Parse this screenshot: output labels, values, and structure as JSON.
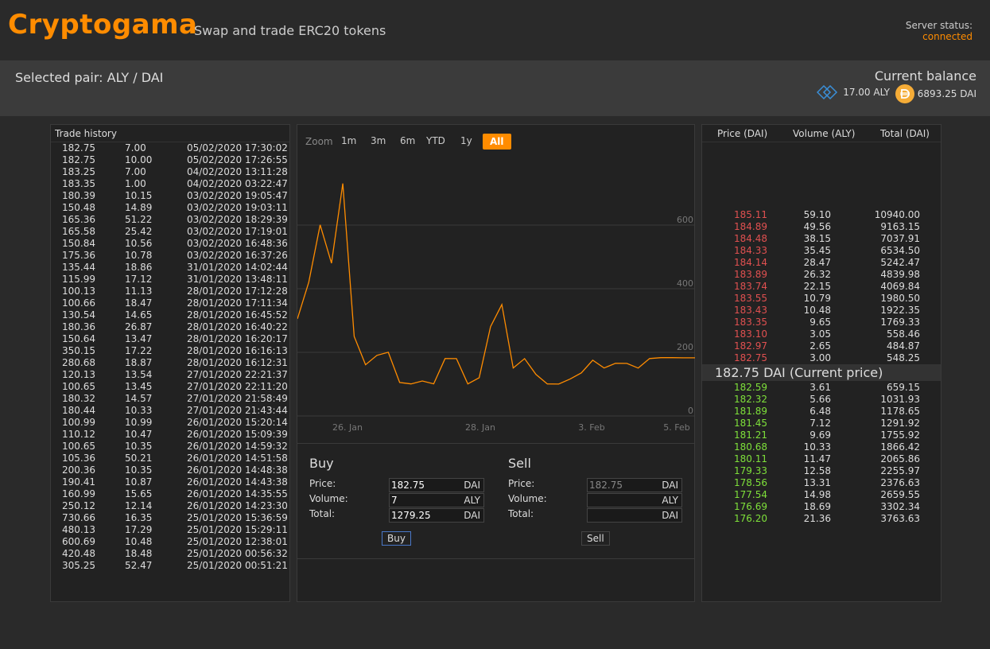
{
  "app": {
    "name": "Cryptogama",
    "tagline": "Swap and trade ERC20 tokens"
  },
  "server": {
    "label": "Server status:",
    "status": "connected"
  },
  "pair": {
    "label": "Selected pair: ALY / DAI"
  },
  "balance": {
    "title": "Current balance",
    "aly": "17.00 ALY",
    "dai": "6893.25 DAI"
  },
  "trade_history": {
    "title": "Trade history",
    "rows": [
      [
        "182.75",
        "7.00",
        "05/02/2020 17:30:02"
      ],
      [
        "182.75",
        "10.00",
        "05/02/2020 17:26:55"
      ],
      [
        "183.25",
        "7.00",
        "04/02/2020 13:11:28"
      ],
      [
        "183.35",
        "1.00",
        "04/02/2020 03:22:47"
      ],
      [
        "180.39",
        "10.15",
        "03/02/2020 19:05:47"
      ],
      [
        "150.48",
        "14.89",
        "03/02/2020 19:03:11"
      ],
      [
        "165.36",
        "51.22",
        "03/02/2020 18:29:39"
      ],
      [
        "165.58",
        "25.42",
        "03/02/2020 17:19:01"
      ],
      [
        "150.84",
        "10.56",
        "03/02/2020 16:48:36"
      ],
      [
        "175.36",
        "10.78",
        "03/02/2020 16:37:26"
      ],
      [
        "135.44",
        "18.86",
        "31/01/2020 14:02:44"
      ],
      [
        "115.99",
        "17.12",
        "31/01/2020 13:48:11"
      ],
      [
        "100.13",
        "11.13",
        "28/01/2020 17:12:28"
      ],
      [
        "100.66",
        "18.47",
        "28/01/2020 17:11:34"
      ],
      [
        "130.54",
        "14.65",
        "28/01/2020 16:45:52"
      ],
      [
        "180.36",
        "26.87",
        "28/01/2020 16:40:22"
      ],
      [
        "150.64",
        "13.47",
        "28/01/2020 16:20:17"
      ],
      [
        "350.15",
        "17.22",
        "28/01/2020 16:16:13"
      ],
      [
        "280.68",
        "18.87",
        "28/01/2020 16:12:31"
      ],
      [
        "120.13",
        "13.54",
        "27/01/2020 22:21:37"
      ],
      [
        "100.65",
        "13.45",
        "27/01/2020 22:11:20"
      ],
      [
        "180.32",
        "14.57",
        "27/01/2020 21:58:49"
      ],
      [
        "180.44",
        "10.33",
        "27/01/2020 21:43:44"
      ],
      [
        "100.99",
        "10.99",
        "26/01/2020 15:20:14"
      ],
      [
        "110.12",
        "10.47",
        "26/01/2020 15:09:39"
      ],
      [
        "100.65",
        "10.35",
        "26/01/2020 14:59:32"
      ],
      [
        "105.36",
        "50.21",
        "26/01/2020 14:51:58"
      ],
      [
        "200.36",
        "10.35",
        "26/01/2020 14:48:38"
      ],
      [
        "190.41",
        "10.87",
        "26/01/2020 14:43:38"
      ],
      [
        "160.99",
        "15.65",
        "26/01/2020 14:35:55"
      ],
      [
        "250.12",
        "12.14",
        "26/01/2020 14:23:30"
      ],
      [
        "730.66",
        "16.35",
        "25/01/2020 15:36:59"
      ],
      [
        "480.13",
        "17.29",
        "25/01/2020 15:29:11"
      ],
      [
        "600.69",
        "10.48",
        "25/01/2020 12:38:01"
      ],
      [
        "420.48",
        "18.48",
        "25/01/2020 00:56:32"
      ],
      [
        "305.25",
        "52.47",
        "25/01/2020 00:51:21"
      ]
    ]
  },
  "zoom": {
    "label": "Zoom",
    "options": [
      "1m",
      "3m",
      "6m",
      "YTD",
      "1y",
      "All"
    ],
    "selected": "All"
  },
  "colors": {
    "accent": "#ff8c00",
    "sell": "#e05050",
    "buy": "#7ee03a"
  },
  "chart_data": {
    "type": "line",
    "title": "",
    "xlabel": "",
    "ylabel": "",
    "ylim": [
      0,
      800
    ],
    "yticks": [
      "0",
      "200",
      "400",
      "600"
    ],
    "xticks": [
      "26. Jan",
      "28. Jan",
      "3. Feb",
      "5. Feb"
    ],
    "series": [
      {
        "values": [
          305.25,
          420.48,
          600.69,
          480.13,
          730.66,
          250.12,
          160.99,
          190.41,
          200.36,
          105.36,
          100.65,
          110.12,
          100.99,
          180.44,
          180.32,
          100.65,
          120.13,
          280.68,
          350.15,
          150.64,
          180.36,
          130.54,
          100.66,
          100.13,
          115.99,
          135.44,
          175.36,
          150.84,
          165.58,
          165.36,
          150.48,
          180.39,
          183.35,
          183.25,
          182.75,
          182.75
        ]
      }
    ]
  },
  "buy_form": {
    "title": "Buy",
    "price_label": "Price:",
    "volume_label": "Volume:",
    "total_label": "Total:",
    "price": "182.75",
    "volume": "7",
    "total": "1279.25",
    "cur_price": "DAI",
    "cur_volume": "ALY",
    "cur_total": "DAI",
    "button": "Buy"
  },
  "sell_form": {
    "title": "Sell",
    "price_label": "Price:",
    "volume_label": "Volume:",
    "total_label": "Total:",
    "price_placeholder": "182.75",
    "cur_price": "DAI",
    "cur_volume": "ALY",
    "cur_total": "DAI",
    "button": "Sell"
  },
  "order_book": {
    "headers": {
      "price": "Price (DAI)",
      "volume": "Volume (ALY)",
      "total": "Total (DAI)"
    },
    "sells": [
      [
        "185.11",
        "59.10",
        "10940.00"
      ],
      [
        "184.89",
        "49.56",
        "9163.15"
      ],
      [
        "184.48",
        "38.15",
        "7037.91"
      ],
      [
        "184.33",
        "35.45",
        "6534.50"
      ],
      [
        "184.14",
        "28.47",
        "5242.47"
      ],
      [
        "183.89",
        "26.32",
        "4839.98"
      ],
      [
        "183.74",
        "22.15",
        "4069.84"
      ],
      [
        "183.55",
        "10.79",
        "1980.50"
      ],
      [
        "183.43",
        "10.48",
        "1922.35"
      ],
      [
        "183.35",
        "9.65",
        "1769.33"
      ],
      [
        "183.10",
        "3.05",
        "558.46"
      ],
      [
        "182.97",
        "2.65",
        "484.87"
      ],
      [
        "182.75",
        "3.00",
        "548.25"
      ]
    ],
    "current_price": "182.75 DAI (Current price)",
    "buys": [
      [
        "182.59",
        "3.61",
        "659.15"
      ],
      [
        "182.32",
        "5.66",
        "1031.93"
      ],
      [
        "181.89",
        "6.48",
        "1178.65"
      ],
      [
        "181.45",
        "7.12",
        "1291.92"
      ],
      [
        "181.21",
        "9.69",
        "1755.92"
      ],
      [
        "180.68",
        "10.33",
        "1866.42"
      ],
      [
        "180.11",
        "11.47",
        "2065.86"
      ],
      [
        "179.33",
        "12.58",
        "2255.97"
      ],
      [
        "178.56",
        "13.31",
        "2376.63"
      ],
      [
        "177.54",
        "14.98",
        "2659.55"
      ],
      [
        "176.69",
        "18.69",
        "3302.34"
      ],
      [
        "176.20",
        "21.36",
        "3763.63"
      ]
    ]
  }
}
